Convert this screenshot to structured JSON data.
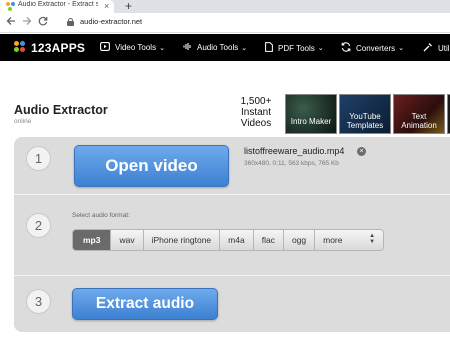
{
  "browser": {
    "tab_title": "Audio Extractor - Extract sound fr",
    "tab_close": "×",
    "new_tab": "+",
    "url": "audio-extractor.net"
  },
  "site": {
    "logo_text": "123APPS",
    "nav": [
      {
        "label": "Video Tools",
        "icon": "video-icon"
      },
      {
        "label": "Audio Tools",
        "icon": "audio-wave-icon"
      },
      {
        "label": "PDF Tools",
        "icon": "document-icon"
      },
      {
        "label": "Converters",
        "icon": "convert-icon"
      },
      {
        "label": "Utili",
        "icon": "tools-icon"
      }
    ]
  },
  "header": {
    "title": "Audio Extractor",
    "subtitle": "online",
    "promo_text": "1,500+ Instant Videos",
    "promos": [
      {
        "label": "Intro Maker"
      },
      {
        "label": "YouTube Templates"
      },
      {
        "label": "Text Animation"
      }
    ]
  },
  "steps": {
    "step1_num": "1",
    "open_label": "Open video",
    "file_name": "listoffreeware_audio.mp4",
    "file_remove": "×",
    "file_info": "360x480, 0:11, 563 kbps, 765 Kb",
    "step2_num": "2",
    "format_label": "Select audio format:",
    "formats": [
      "mp3",
      "wav",
      "iPhone ringtone",
      "m4a",
      "flac",
      "ogg",
      "more"
    ],
    "selected_format": "mp3",
    "step3_num": "3",
    "extract_label": "Extract audio"
  },
  "colors": {
    "accent_blue": "#4a8fe0",
    "nav_bg": "#000000",
    "panel_bg": "#dcdcdc"
  }
}
